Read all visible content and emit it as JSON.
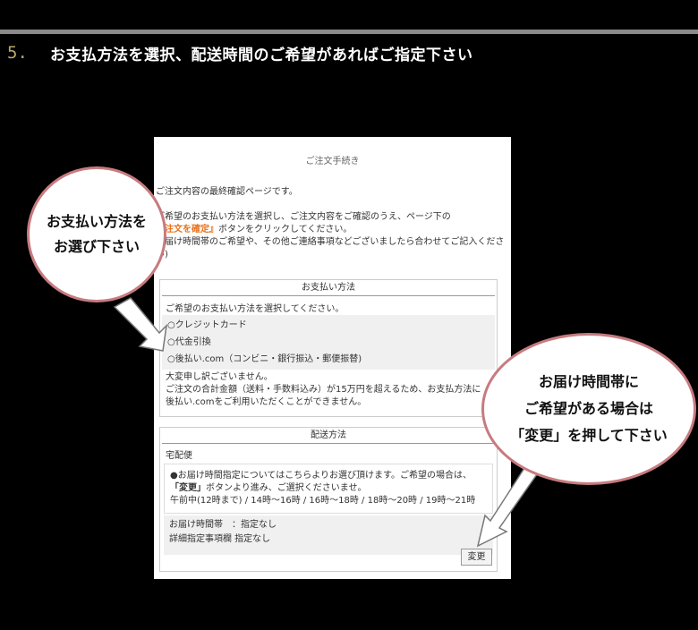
{
  "step": {
    "number": "5.",
    "text": "お支払方法を選択、配送時間のご希望があればご指定下さい"
  },
  "panel": {
    "title": "ご注文手続き",
    "intro_line1": "ご注文内容の最終確認ページです。",
    "intro_line2_prefix": "ご希望のお支払い方法を選択し、ご注文内容をご確認のうえ、ページ下の",
    "intro_highlight": "『注文を確定』",
    "intro_line2_suffix": "ボタンをクリックしてください。",
    "intro_line3": "お届け時間帯のご希望や、その他ご連絡事項などございましたら合わせてご記入ください)",
    "payment": {
      "heading": "お支払い方法",
      "instruction": "ご希望のお支払い方法を選択してください。",
      "options": [
        "○クレジットカード",
        "○代金引換",
        "○後払い.com（コンビニ・銀行振込・郵便振替)"
      ],
      "note_lines": [
        "大変申し訳ございません。",
        "ご注文の合計金額（送料・手数料込み）が15万円を超えるため、お支払方法に",
        "後払い.comをご利用いただくことができません。"
      ]
    },
    "shipping": {
      "heading": "配送方法",
      "type": "宅配便",
      "detail_line1": "●お届け時間指定についてはこちらよりお選び頂けます。ご希望の場合は、",
      "detail_bold": "「変更」",
      "detail_line2_suffix": "ボタンより進み、ご選択くださいませ。",
      "detail_line3": "午前中(12時まで) / 14時～16時 / 16時～18時 / 18時～20時 / 19時～21時",
      "time_label": "お届け時間帯　：指定なし",
      "detail_label": "詳細指定事項欄  指定なし",
      "change_button": "変更"
    }
  },
  "callouts": {
    "left_line1": "お支払い方法を",
    "left_line2": "お選び下さい",
    "right_line1": "お届け時間帯に",
    "right_line2": "ご希望がある場合は",
    "right_line3": "「変更」を押して下さい"
  }
}
